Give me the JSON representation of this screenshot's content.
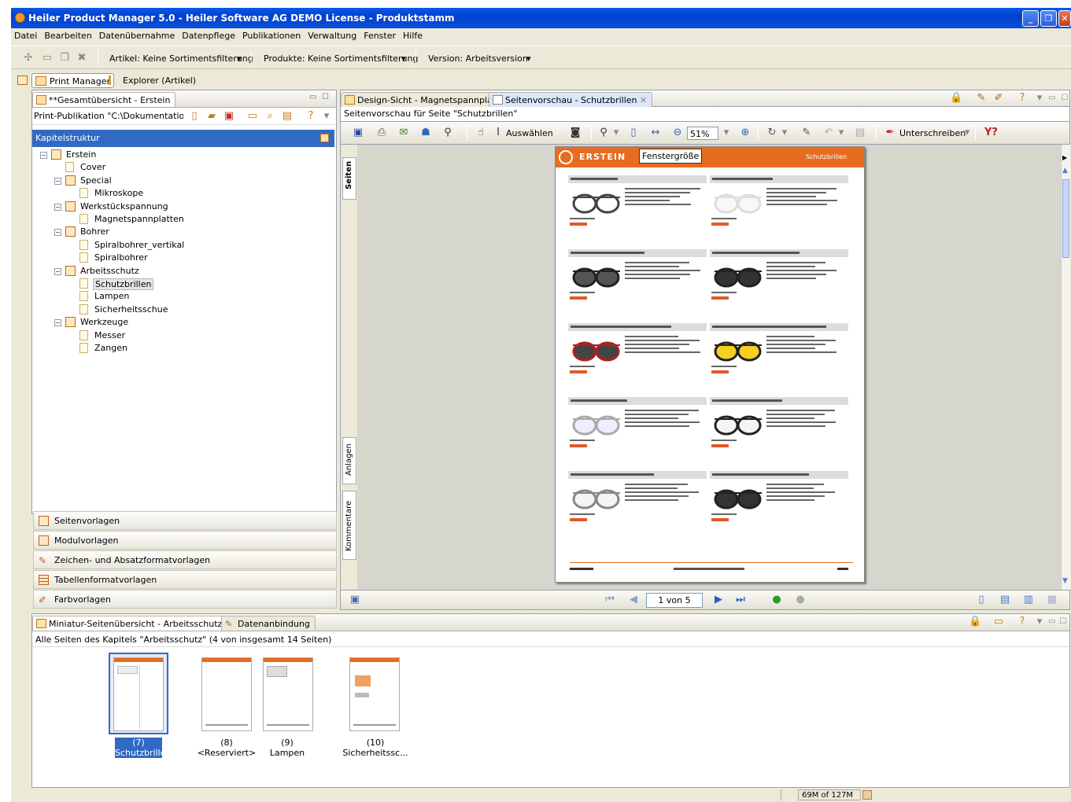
{
  "window": {
    "title": "Heiler Product Manager 5.0 - Heiler Software AG DEMO License - Produktstamm"
  },
  "menu": [
    "Datei",
    "Bearbeiten",
    "Datenübernahme",
    "Datenpflege",
    "Publikationen",
    "Verwaltung",
    "Fenster",
    "Hilfe"
  ],
  "toolbar": {
    "artikel": "Artikel: Keine Sortimentsfilterung",
    "produkte": "Produkte: Keine Sortimentsfilterung",
    "version": "Version: Arbeitsversion"
  },
  "perspectives": [
    "Print Manager",
    "Explorer (Artikel)"
  ],
  "left_panel": {
    "tab": "**Gesamtübersicht - Erstein",
    "path": "Print-Publikation \"C:\\Dokumentation_worl",
    "section": "Kapitelstruktur",
    "tree": [
      {
        "label": "Erstein",
        "level": 0,
        "type": "folder"
      },
      {
        "label": "Cover",
        "level": 1,
        "type": "page"
      },
      {
        "label": "Special",
        "level": 1,
        "type": "folder"
      },
      {
        "label": "Mikroskope",
        "level": 2,
        "type": "page"
      },
      {
        "label": "Werkstückspannung",
        "level": 1,
        "type": "folder"
      },
      {
        "label": "Magnetspannplatten",
        "level": 2,
        "type": "page"
      },
      {
        "label": "Bohrer",
        "level": 1,
        "type": "folder"
      },
      {
        "label": "Spiralbohrer_vertikal",
        "level": 2,
        "type": "page"
      },
      {
        "label": "Spiralbohrer",
        "level": 2,
        "type": "page"
      },
      {
        "label": "Arbeitsschutz",
        "level": 1,
        "type": "folder"
      },
      {
        "label": "Schutzbrillen",
        "level": 2,
        "type": "page",
        "selected": true
      },
      {
        "label": "Lampen",
        "level": 2,
        "type": "page"
      },
      {
        "label": "Sicherheitsschue",
        "level": 2,
        "type": "page"
      },
      {
        "label": "Werkzeuge",
        "level": 1,
        "type": "folder"
      },
      {
        "label": "Messer",
        "level": 2,
        "type": "page"
      },
      {
        "label": "Zangen",
        "level": 2,
        "type": "page"
      }
    ],
    "stack": [
      "Seitenvorlagen",
      "Modulvorlagen",
      "Zeichen- und Absatzformatvorlagen",
      "Tabellenformatvorlagen",
      "Farbvorlagen"
    ]
  },
  "editor": {
    "tabs": [
      "Design-Sicht - Magnetspannplatten",
      "Seitenvorschau - Schutzbrillen"
    ],
    "subtitle": "Seitenvorschau für Seite \"Schutzbrillen\"",
    "auswaehlen": "Auswählen",
    "zoom": "51%",
    "unterschreiben": "Unterschreiben",
    "side_tabs": [
      "Seiten",
      "Anlagen",
      "Kommentare"
    ],
    "page_header_brand": "ERSTEIN",
    "page_header_box": "Fenstergröße",
    "page_header_right": "Schutzbrillen",
    "page_nav": "1 von 5"
  },
  "bottom_panel": {
    "tabs": [
      "Miniatur-Seitenübersicht - Arbeitsschutz",
      "Datenanbindung"
    ],
    "description": "Alle Seiten des Kapitels \"Arbeitsschutz\" (4 von insgesamt 14 Seiten)",
    "thumbnails": [
      {
        "num": "(7)",
        "name": "Schutzbrillen",
        "selected": true
      },
      {
        "num": "(8)",
        "name": "<Reserviert>"
      },
      {
        "num": "(9)",
        "name": "Lampen"
      },
      {
        "num": "(10)",
        "name": "Sicherheitssc..."
      }
    ]
  },
  "status": {
    "memory": "69M of 127M"
  },
  "colors": {
    "accent_orange": "#e86c20",
    "selection_blue": "#316ac5",
    "titlebar_blue": "#0a4fd8"
  }
}
